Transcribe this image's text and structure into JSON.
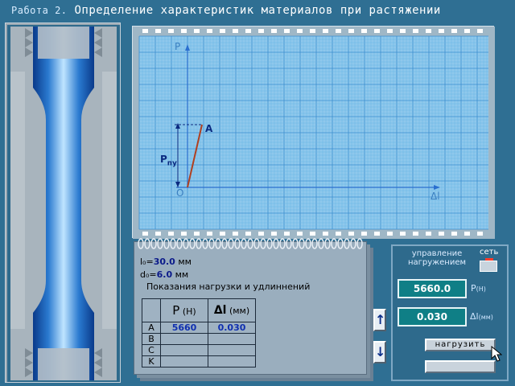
{
  "title": {
    "work": "Работа 2.",
    "text": "Определение характеристик материалов при растяжении"
  },
  "graph": {
    "y_axis_label": "P",
    "x_axis_label": "Δl",
    "origin_label": "O",
    "point_label": "A",
    "py_label": "P",
    "py_sub": "пу"
  },
  "notebook": {
    "l0_label": "l₀=",
    "l0_value": "30.0",
    "l0_unit": "мм",
    "d0_label": "d₀=",
    "d0_value": "6.0",
    "d0_unit": "мм",
    "table_caption": "Показания нагрузки и удлиннений",
    "col_p": "P",
    "col_p_unit": "(Н)",
    "col_dl": "Δl",
    "col_dl_unit": "(мм)",
    "rows": [
      {
        "label": "A",
        "p": "5660",
        "dl": "0.030"
      },
      {
        "label": "B",
        "p": "",
        "dl": ""
      },
      {
        "label": "C",
        "p": "",
        "dl": ""
      },
      {
        "label": "K",
        "p": "",
        "dl": ""
      }
    ]
  },
  "scroll": {
    "up": "↑",
    "down": "↓"
  },
  "control": {
    "title_line1": "управление",
    "title_line2": "нагружением",
    "net_label": "сеть",
    "load_value": "5660.0",
    "load_unit": "P",
    "load_unit_small": "(Н)",
    "elong_value": "0.030",
    "elong_unit": "Δl",
    "elong_unit_small": "(мм)",
    "load_button": "нагрузить",
    "blank_button": ""
  },
  "colors": {
    "background": "#2f6f93",
    "grid": "#5aaee0",
    "readout": "#0f7f86",
    "line": "#b04020"
  }
}
